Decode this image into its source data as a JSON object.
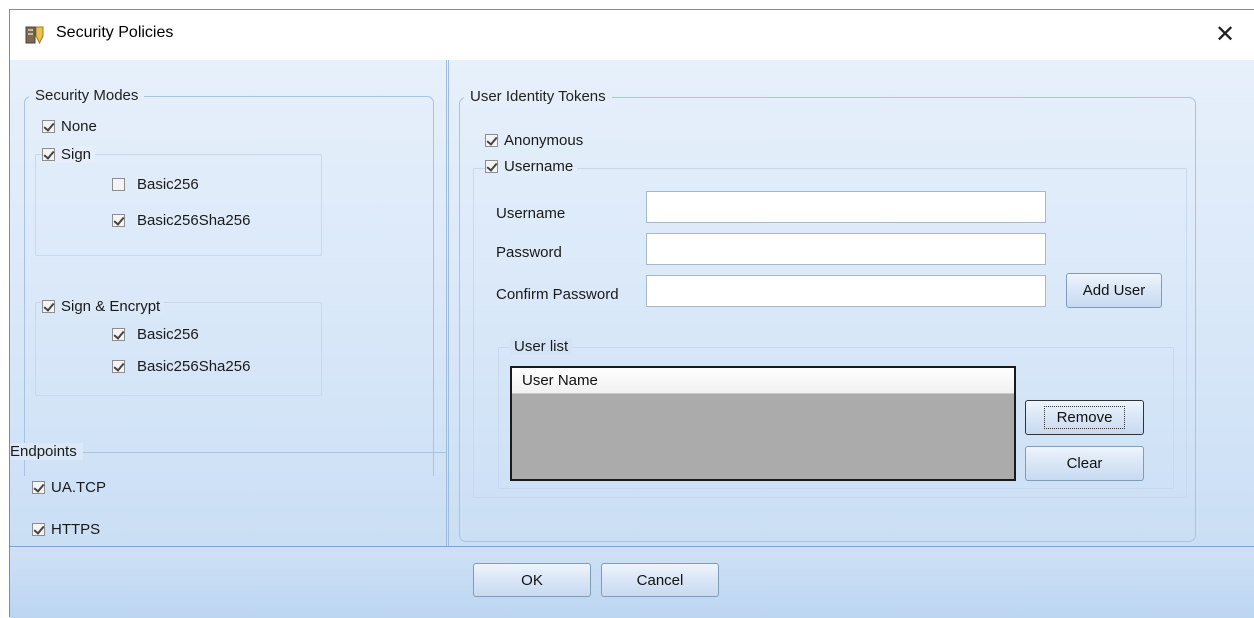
{
  "window": {
    "title": "Security Policies",
    "close_glyph": "✕"
  },
  "security_modes": {
    "legend": "Security Modes",
    "none": {
      "label": "None",
      "checked": true
    },
    "sign": {
      "label": "Sign",
      "checked": true,
      "basic256": {
        "label": "Basic256",
        "checked": false
      },
      "basic256sha256": {
        "label": "Basic256Sha256",
        "checked": true
      }
    },
    "sign_encrypt": {
      "label": "Sign & Encrypt",
      "checked": true,
      "basic256": {
        "label": "Basic256",
        "checked": true
      },
      "basic256sha256": {
        "label": "Basic256Sha256",
        "checked": true
      }
    }
  },
  "endpoints": {
    "legend": "Endpoints",
    "uatcp": {
      "label": "UA.TCP",
      "checked": true
    },
    "https": {
      "label": "HTTPS",
      "checked": true
    }
  },
  "user_identity": {
    "legend": "User Identity Tokens",
    "anonymous": {
      "label": "Anonymous",
      "checked": true
    },
    "username_token": {
      "label": "Username",
      "checked": true
    },
    "username_label": "Username",
    "username_value": "",
    "password_label": "Password",
    "password_value": "",
    "confirm_label": "Confirm Password",
    "confirm_value": "",
    "add_user_label": "Add User",
    "user_list": {
      "legend": "User list",
      "column_header": "User Name",
      "rows": []
    },
    "remove_label": "Remove",
    "clear_label": "Clear"
  },
  "footer": {
    "ok_label": "OK",
    "cancel_label": "Cancel"
  },
  "colors": {
    "panel_top": "#e7f0fb",
    "panel_bottom": "#c5dbf3",
    "grid_body": "#ababab",
    "border": "#a9c3e2"
  },
  "icons": {
    "app": "security-policies-icon",
    "close": "close-icon",
    "check": "checkmark-icon"
  }
}
